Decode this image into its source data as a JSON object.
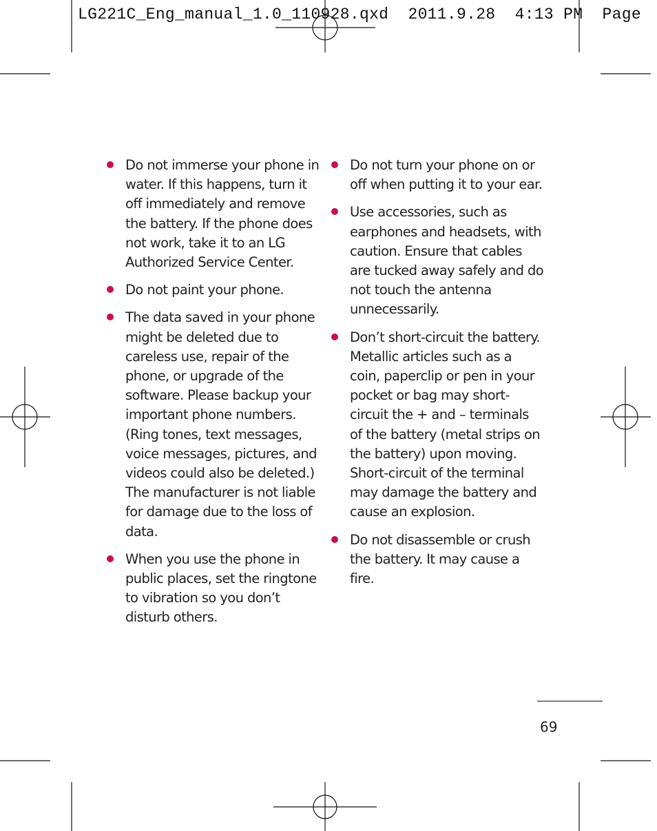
{
  "slug_line": "LG221C_Eng_manual_1.0_110928.qxd  2011.9.28  4:13 PM  Page",
  "colors": {
    "bullet": "#c8104a",
    "text": "#231f20"
  },
  "left_column": {
    "items": [
      {
        "text": "Do not immerse your phone in water. If this happens, turn it off immediately and remove the battery. If the phone does not work, take it to an LG Authorized Service Center."
      },
      {
        "text": "Do not paint your phone."
      },
      {
        "text": "The data saved in your phone might be deleted due to careless use, repair of the phone, or upgrade of the software. Please backup your important phone numbers. (Ring tones, text messages, voice messages, pictures, and videos could also be deleted.) The manufacturer is not liable for damage due to the loss of data."
      },
      {
        "text": "When you use the phone in public places, set the ringtone to vibration so you don’t disturb others."
      }
    ]
  },
  "right_column": {
    "items": [
      {
        "text": "Do not turn your phone on or off when putting it to your ear."
      },
      {
        "text": "Use accessories, such as earphones and headsets, with caution. Ensure that cables are tucked away safely and do not touch the antenna unnecessarily."
      },
      {
        "text": "Don’t short-circuit the battery. Metallic articles such as a coin, paperclip or pen in your pocket or bag may short-circuit the + and – terminals of the battery (metal strips on the battery) upon moving. Short-circuit of the terminal may damage the battery and cause an explosion."
      },
      {
        "text": "Do not disassemble or crush the battery. It may cause a fire."
      }
    ]
  },
  "page_number": "69"
}
